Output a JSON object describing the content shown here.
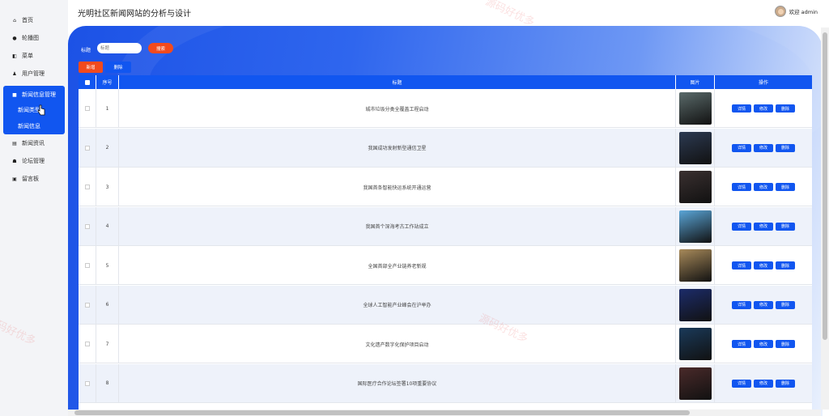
{
  "app": {
    "title": "光明社区新闻网站的分析与设计"
  },
  "user": {
    "greeting": "欢迎 admin"
  },
  "sidebar": {
    "items": [
      {
        "label": "首页",
        "icon": "home-icon"
      },
      {
        "label": "轮播图",
        "icon": "slideshow-icon"
      },
      {
        "label": "菜单",
        "icon": "menu-icon"
      },
      {
        "label": "用户管理",
        "icon": "user-icon"
      }
    ],
    "group": {
      "label": "新闻信息管理",
      "icon": "news-icon",
      "children": [
        "新闻类型",
        "新闻信息"
      ]
    },
    "items_after": [
      {
        "label": "新闻资讯",
        "icon": "article-icon"
      },
      {
        "label": "论坛管理",
        "icon": "forum-icon"
      },
      {
        "label": "留言板",
        "icon": "message-icon"
      }
    ]
  },
  "search": {
    "label": "标题",
    "placeholder": "标题",
    "button": "搜索"
  },
  "toolbar": {
    "add": "新增",
    "delete": "删除"
  },
  "table": {
    "headers": [
      "序号",
      "标题",
      "图片",
      "操作"
    ],
    "actions": [
      "详情",
      "修改",
      "删除"
    ],
    "rows": [
      {
        "no": "1",
        "title": "城市垃圾分类全覆盖工程启动",
        "img": "#5a6a6a"
      },
      {
        "no": "2",
        "title": "我国成功发射新型通信卫星",
        "img": "#2c3a52"
      },
      {
        "no": "3",
        "title": "我国首条智能快运系统开通运营",
        "img": "#3a3030"
      },
      {
        "no": "4",
        "title": "我国首个深海考古工作站成立",
        "img": "#5aa6d8"
      },
      {
        "no": "5",
        "title": "全国首部全产业链养老新规",
        "img": "#a88a5a"
      },
      {
        "no": "6",
        "title": "全球人工智能产业峰会在沪举办",
        "img": "#1c2c6a"
      },
      {
        "no": "7",
        "title": "文化遗产数字化保护项目启动",
        "img": "#1a3a5a"
      },
      {
        "no": "8",
        "title": "国际医疗合作论坛签署10项重要协议",
        "img": "#4a2a2a"
      }
    ]
  },
  "watermark": "源码好优多",
  "colors": {
    "primary": "#1156f0",
    "accent": "#f24a1d"
  }
}
